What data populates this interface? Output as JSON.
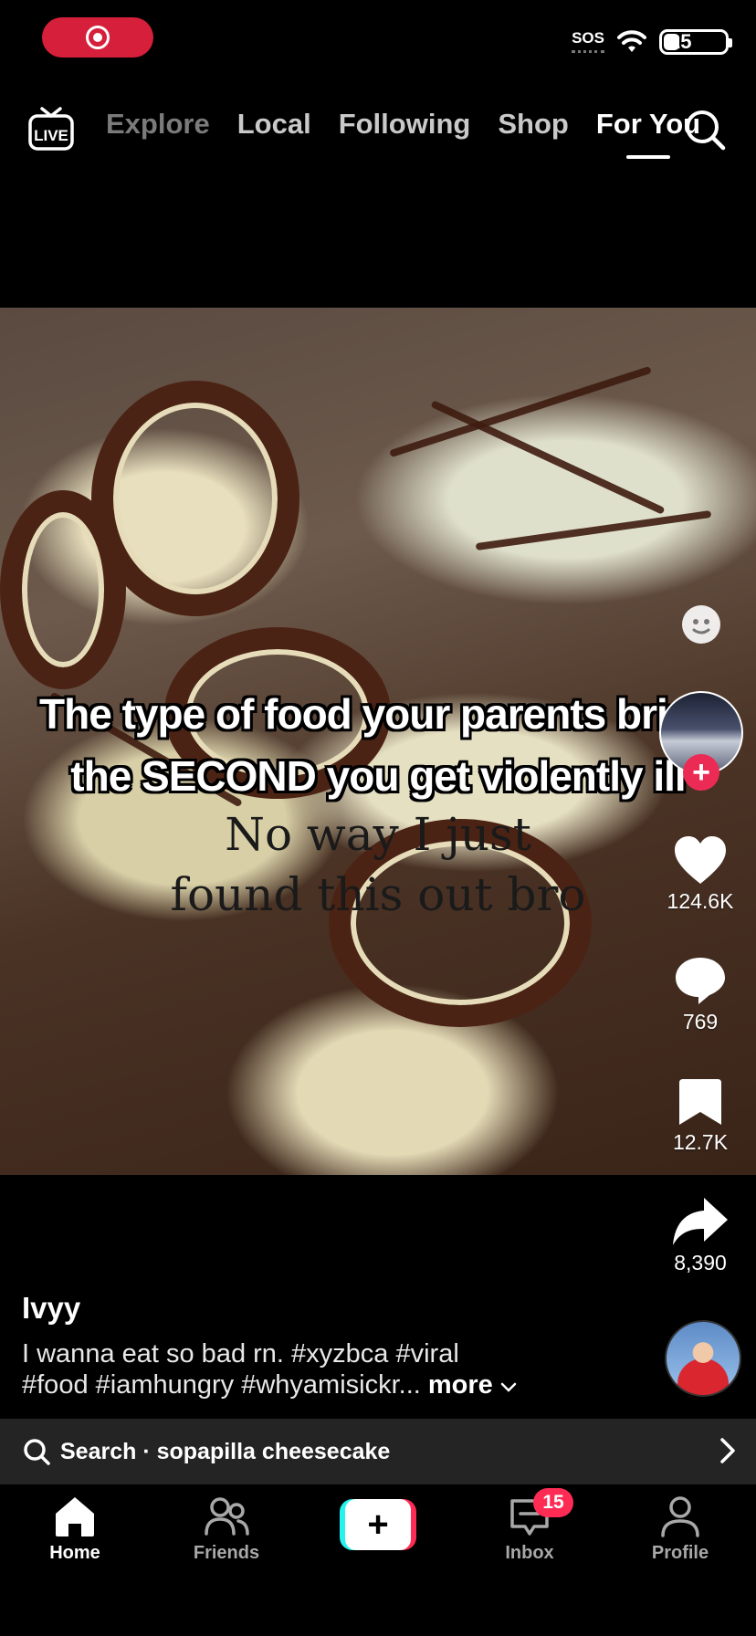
{
  "status_bar": {
    "sos": "SOS",
    "battery": "25",
    "battery_level": 0.25
  },
  "top_nav": {
    "live_label": "LIVE",
    "tabs": [
      "Explore",
      "Local",
      "Following",
      "Shop",
      "For You"
    ],
    "active_tab": "For You"
  },
  "video": {
    "overlay_line1": "The type of food your parents bring",
    "overlay_line2": "the SECOND you get violently ill",
    "serif_line1": "No way I just",
    "serif_line2": "found this out bro"
  },
  "actions": {
    "likes": "124.6K",
    "comments": "769",
    "saves": "12.7K",
    "shares": "8,390"
  },
  "post": {
    "username": "Ivyy",
    "description_line1": "I wanna eat so bad rn. #xyzbca #viral",
    "description_line2": "#food #iamhungry #whyamisickr...",
    "more": "more"
  },
  "search_suggestion": {
    "text": "Search · sopapilla cheesecake"
  },
  "bottom_nav": {
    "home": "Home",
    "friends": "Friends",
    "inbox": "Inbox",
    "inbox_badge": "15",
    "profile": "Profile"
  },
  "colors": {
    "accent_red": "#fe2c55",
    "accent_cyan": "#25f4ee",
    "record_red": "#d61f3a"
  }
}
